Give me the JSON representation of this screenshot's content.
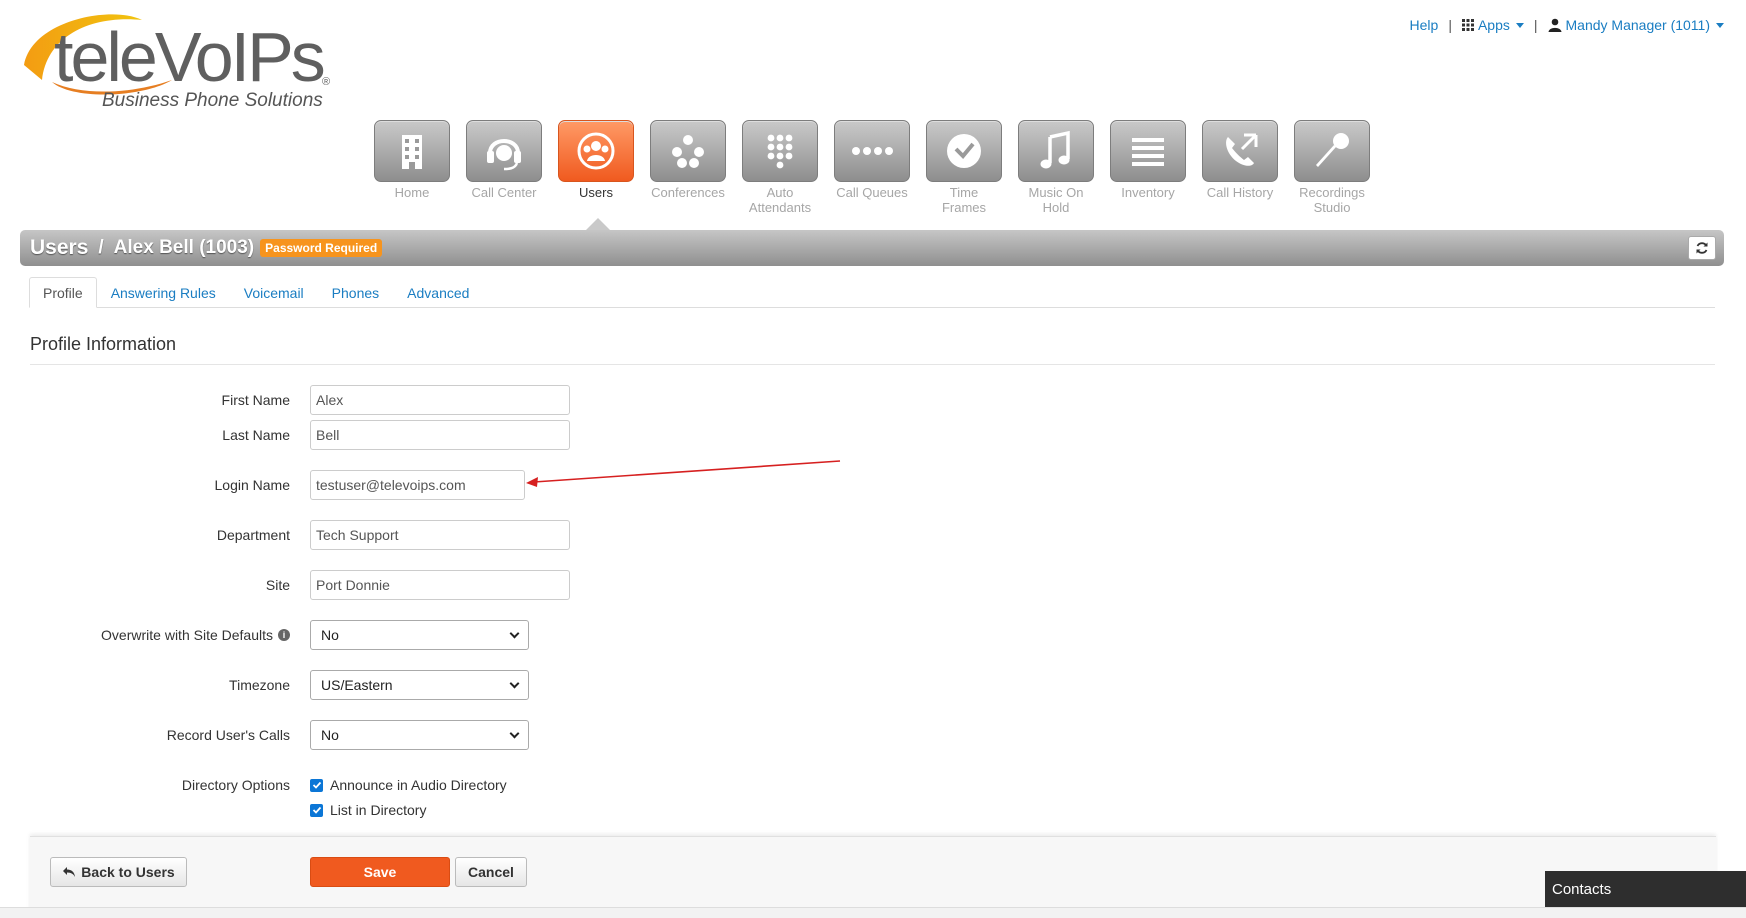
{
  "logo": {
    "wordmark": "teleVoIPs",
    "tagline": "Business Phone Solutions",
    "reg": "®"
  },
  "topbar": {
    "help": "Help",
    "apps": "Apps",
    "user": "Mandy Manager (1011)"
  },
  "nav": [
    {
      "label": "Home",
      "icon": "building-icon"
    },
    {
      "label": "Call Center",
      "icon": "headset-icon"
    },
    {
      "label": "Users",
      "icon": "users-icon",
      "active": true
    },
    {
      "label": "Conferences",
      "icon": "conference-icon"
    },
    {
      "label": "Auto Attendants",
      "icon": "keypad-icon"
    },
    {
      "label": "Call Queues",
      "icon": "queue-icon"
    },
    {
      "label": "Time Frames",
      "icon": "clock-icon"
    },
    {
      "label": "Music On Hold",
      "icon": "music-note-icon"
    },
    {
      "label": "Inventory",
      "icon": "list-icon"
    },
    {
      "label": "Call History",
      "icon": "phone-history-icon"
    },
    {
      "label": "Recordings Studio",
      "icon": "microphone-icon"
    }
  ],
  "titlebar": {
    "section": "Users",
    "separator": "/",
    "user": "Alex Bell (1003)",
    "badge": "Password Required"
  },
  "tabs": [
    "Profile",
    "Answering Rules",
    "Voicemail",
    "Phones",
    "Advanced"
  ],
  "section_title": "Profile Information",
  "form": {
    "first_name": {
      "label": "First Name",
      "value": "Alex"
    },
    "last_name": {
      "label": "Last Name",
      "value": "Bell"
    },
    "login_name": {
      "label": "Login Name",
      "value": "testuser@televoips.com"
    },
    "department": {
      "label": "Department",
      "value": "Tech Support"
    },
    "site": {
      "label": "Site",
      "value": "Port Donnie"
    },
    "overwrite": {
      "label": "Overwrite with Site Defaults",
      "value": "No"
    },
    "timezone": {
      "label": "Timezone",
      "value": "US/Eastern"
    },
    "record_calls": {
      "label": "Record User's Calls",
      "value": "No"
    },
    "directory": {
      "label": "Directory Options",
      "announce": "Announce in Audio Directory",
      "list": "List in Directory"
    }
  },
  "footer": {
    "back": "Back to Users",
    "save": "Save",
    "cancel": "Cancel"
  },
  "contacts": "Contacts",
  "colors": {
    "accent": "#f05a1f",
    "link": "#1a7dc2",
    "badge": "#f7941d"
  }
}
